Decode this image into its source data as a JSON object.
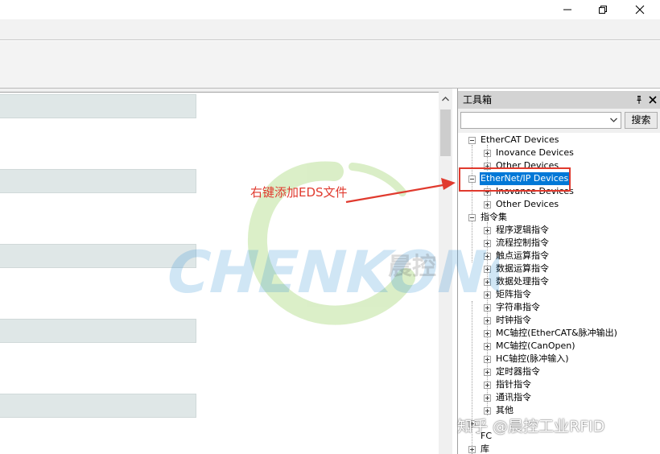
{
  "toolbox": {
    "title": "工具箱",
    "search_value": "",
    "search_button": "搜索"
  },
  "tree": {
    "ethercat_devices": "EtherCAT Devices",
    "ethercat_inovance": "Inovance Devices",
    "ethercat_other": "Other Devices",
    "ethernetip_devices": "EtherNet/IP Devices",
    "ethernetip_inovance": "Inovance Devices",
    "ethernetip_other": "Other Devices",
    "instruction_set": "指令集",
    "instructions": [
      "程序逻辑指令",
      "流程控制指令",
      "触点运算指令",
      "数据运算指令",
      "数据处理指令",
      "矩阵指令",
      "字符串指令",
      "时钟指令",
      "MC轴控(EtherCAT&脉冲输出)",
      "MC轴控(CanOpen)",
      "HC轴控(脉冲输入)",
      "定时器指令",
      "指针指令",
      "通讯指令",
      "其他"
    ],
    "fc": "FC",
    "lib": "库"
  },
  "annotation": {
    "text": "右键添加EDS文件",
    "color": "#e03a2e"
  },
  "watermark": {
    "logo_text": "CHENKONG",
    "logo_cn": "晨控",
    "zhihu": "知乎 @晨控工业RFID"
  },
  "colors": {
    "selection": "#0078d7",
    "band": "#dfe7e7",
    "panel_header": "#d3d3d3"
  }
}
